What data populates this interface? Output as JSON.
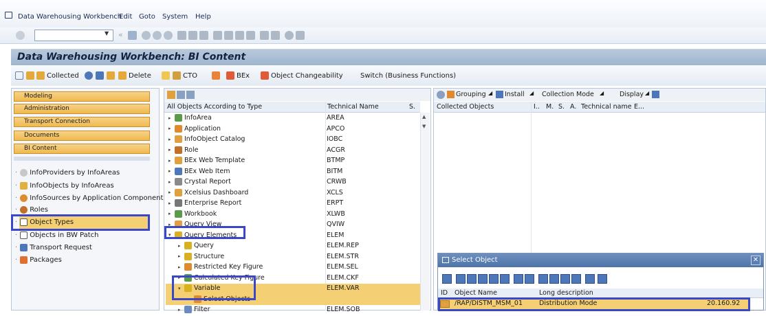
{
  "menu": {
    "items": [
      "Data Warehousing Workbench",
      "Edit",
      "Goto",
      "System",
      "Help"
    ]
  },
  "title": "Data Warehousing Workbench: BI Content",
  "app_toolbar": {
    "collected": "Collected",
    "delete": "Delete",
    "cto": "CTO",
    "bex": "BEx",
    "object_changeability": "Object Changeability",
    "switch": "Switch (Business Functions)"
  },
  "nav": {
    "buttons": [
      "Modeling",
      "Administration",
      "Transport Connection",
      "Documents",
      "BI Content"
    ],
    "tree": [
      "InfoProviders by InfoAreas",
      "InfoObjects by InfoAreas",
      "InfoSources by Application Component",
      "Roles",
      "Object Types",
      "Objects in BW Patch",
      "Transport Request",
      "Packages"
    ]
  },
  "middle": {
    "header": {
      "col1": "All Objects According to Type",
      "col2": "Technical Name",
      "col3": "S."
    },
    "rows": [
      {
        "name": "InfoArea",
        "tech": "AREA"
      },
      {
        "name": "Application",
        "tech": "APCO"
      },
      {
        "name": "InfoObject Catalog",
        "tech": "IOBC"
      },
      {
        "name": "Role",
        "tech": "ACGR"
      },
      {
        "name": "BEx Web Template",
        "tech": "BTMP"
      },
      {
        "name": "BEx Web Item",
        "tech": "BITM"
      },
      {
        "name": "Crystal Report",
        "tech": "CRWB"
      },
      {
        "name": "Xcelsius Dashboard",
        "tech": "XCLS"
      },
      {
        "name": "Enterprise Report",
        "tech": "ERPT"
      },
      {
        "name": "Workbook",
        "tech": "XLWB"
      },
      {
        "name": "Query View",
        "tech": "QVIW"
      },
      {
        "name": "Query Elements",
        "tech": "ELEM"
      },
      {
        "name": "Query",
        "tech": "ELEM.REP"
      },
      {
        "name": "Structure",
        "tech": "ELEM.STR"
      },
      {
        "name": "Restricted Key Figure",
        "tech": "ELEM.SEL"
      },
      {
        "name": "Calculated Key Figure",
        "tech": "ELEM.CKF"
      },
      {
        "name": "Variable",
        "tech": "ELEM.VAR"
      },
      {
        "name": "Select Objects",
        "tech": ""
      },
      {
        "name": "Filter",
        "tech": "ELEM.SOB"
      }
    ]
  },
  "right": {
    "toolbar": {
      "grouping": "Grouping",
      "install": "Install",
      "collection_mode": "Collection Mode",
      "display": "Display"
    },
    "header": {
      "col1": "Collected Objects",
      "col2": "I..",
      "col3": "M.",
      "col4": "S.",
      "col5": "A.",
      "col6": "Technical name",
      "col7": "E..."
    }
  },
  "popup": {
    "title": "Select Object",
    "columns": {
      "id": "ID",
      "name": "Object Name",
      "desc": "Long description"
    },
    "row": {
      "name": "/RAP/DISTM_MSM_01",
      "desc": "Distribution Mode",
      "value": "20.160.92"
    }
  },
  "colors": {
    "accent": "#3a47c9",
    "nav_button": "#f0b94d",
    "title_bar": "#9fb6cf"
  }
}
